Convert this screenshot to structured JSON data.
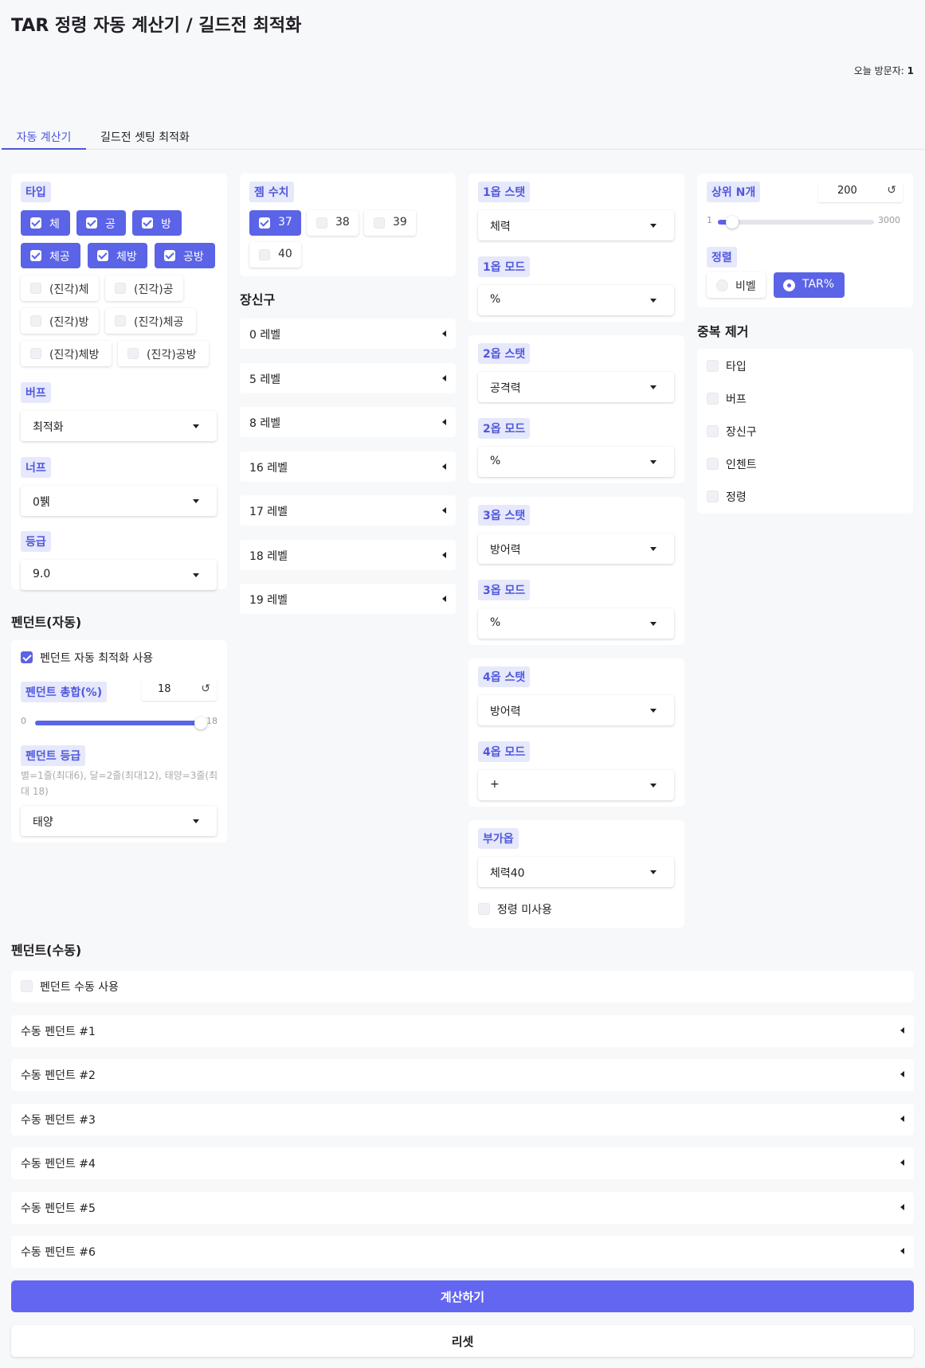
{
  "title": "TAR 정령 자동 계산기 / 길드전 최적화",
  "visitor": {
    "label": "오늘 방문자: ",
    "count": "1"
  },
  "tabs": {
    "auto": "자동 계산기",
    "guild": "길드전 셋팅 최적화"
  },
  "type": {
    "label": "타입",
    "options": [
      {
        "label": "체",
        "checked": true
      },
      {
        "label": "공",
        "checked": true
      },
      {
        "label": "방",
        "checked": true
      },
      {
        "label": "체공",
        "checked": true
      },
      {
        "label": "체방",
        "checked": true
      },
      {
        "label": "공방",
        "checked": true
      },
      {
        "label": "(진각)체",
        "checked": false
      },
      {
        "label": "(진각)공",
        "checked": false
      },
      {
        "label": "(진각)방",
        "checked": false
      },
      {
        "label": "(진각)체공",
        "checked": false
      },
      {
        "label": "(진각)체방",
        "checked": false
      },
      {
        "label": "(진각)공방",
        "checked": false
      }
    ]
  },
  "buff": {
    "label": "버프",
    "value": "최적화"
  },
  "nerf": {
    "label": "너프",
    "value": "0뷁"
  },
  "grade": {
    "label": "등급",
    "value": "9.0"
  },
  "pendant_auto": {
    "section": "펜던트(자동)",
    "use_label": "펜던트 자동 최적화 사용",
    "use_checked": true,
    "total_label": "펜던트 총합(%)",
    "total_value": "18",
    "slider_min": "0",
    "slider_max": "18",
    "slider_fraction": 1.0,
    "grade_label": "펜던트 등급",
    "grade_help": "별=1줄(최대6), 달=2줄(최대12), 태양=3줄(최대 18)",
    "grade_value": "태양"
  },
  "gem": {
    "label": "젬 수치",
    "options": [
      {
        "label": "37",
        "checked": true
      },
      {
        "label": "38",
        "checked": false
      },
      {
        "label": "39",
        "checked": false
      },
      {
        "label": "40",
        "checked": false
      }
    ]
  },
  "accessory": {
    "section": "장신구",
    "items": [
      "0 레벨",
      "5 레벨",
      "8 레벨",
      "16 레벨",
      "17 레벨",
      "18 레벨",
      "19 레벨"
    ]
  },
  "stats": [
    {
      "stat_label": "1옵 스탯",
      "stat_value": "체력",
      "mode_label": "1옵 모드",
      "mode_value": "%"
    },
    {
      "stat_label": "2옵 스탯",
      "stat_value": "공격력",
      "mode_label": "2옵 모드",
      "mode_value": "%"
    },
    {
      "stat_label": "3옵 스탯",
      "stat_value": "방어력",
      "mode_label": "3옵 모드",
      "mode_value": "%"
    },
    {
      "stat_label": "4옵 스탯",
      "stat_value": "방어력",
      "mode_label": "4옵 모드",
      "mode_value": "+"
    }
  ],
  "extra": {
    "label": "부가옵",
    "value": "체력40",
    "no_spirit_label": "정령 미사용"
  },
  "topn": {
    "label": "상위 N개",
    "value": "200",
    "slider_min": "1",
    "slider_max": "3000",
    "slider_value": 200
  },
  "sort": {
    "label": "정렬",
    "options": [
      {
        "label": "비벨",
        "selected": false
      },
      {
        "label": "TAR%",
        "selected": true
      }
    ]
  },
  "dedup": {
    "section": "중복 제거",
    "items": [
      "타입",
      "버프",
      "장신구",
      "인첸트",
      "정령"
    ]
  },
  "pendant_manual": {
    "section": "펜던트(수동)",
    "use_label": "펜던트 수동 사용",
    "items": [
      "수동 펜던트 #1",
      "수동 펜던트 #2",
      "수동 펜던트 #3",
      "수동 펜던트 #4",
      "수동 펜던트 #5",
      "수동 펜던트 #6"
    ]
  },
  "buttons": {
    "calc": "계산하기",
    "reset": "리셋"
  },
  "icons": {
    "refresh": "↺"
  },
  "colors": {
    "accent": "#5b63e6",
    "accent_light": "#e6e8fb",
    "bg": "#f7f8fa"
  }
}
